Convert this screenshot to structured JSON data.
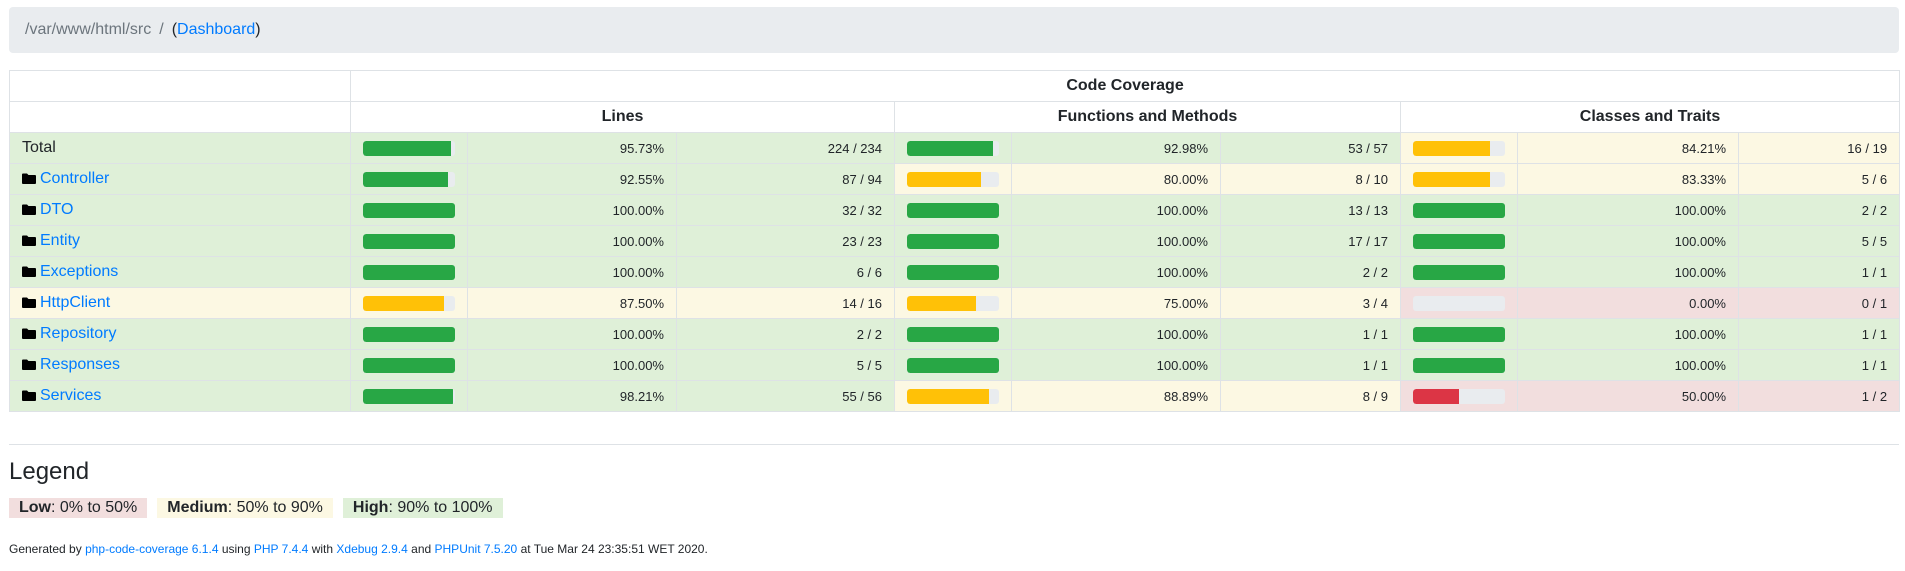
{
  "breadcrumb": {
    "path": "/var/www/html/src",
    "separator": "/",
    "open_paren": "(",
    "link": "Dashboard",
    "close_paren": ")"
  },
  "table": {
    "header_top": "Code Coverage",
    "group_headers": [
      "Lines",
      "Functions and Methods",
      "Classes and Traits"
    ],
    "rows": [
      {
        "name": "Total",
        "is_folder": false,
        "lines": {
          "pct": "95.73%",
          "ratio": "224 / 234",
          "fill": 95.73,
          "level": "high"
        },
        "funcs": {
          "pct": "92.98%",
          "ratio": "53 / 57",
          "fill": 92.98,
          "level": "high"
        },
        "classes": {
          "pct": "84.21%",
          "ratio": "16 / 19",
          "fill": 84.21,
          "level": "medium"
        }
      },
      {
        "name": "Controller",
        "is_folder": true,
        "lines": {
          "pct": "92.55%",
          "ratio": "87 / 94",
          "fill": 92.55,
          "level": "high"
        },
        "funcs": {
          "pct": "80.00%",
          "ratio": "8 / 10",
          "fill": 80.0,
          "level": "medium"
        },
        "classes": {
          "pct": "83.33%",
          "ratio": "5 / 6",
          "fill": 83.33,
          "level": "medium"
        }
      },
      {
        "name": "DTO",
        "is_folder": true,
        "lines": {
          "pct": "100.00%",
          "ratio": "32 / 32",
          "fill": 100,
          "level": "high"
        },
        "funcs": {
          "pct": "100.00%",
          "ratio": "13 / 13",
          "fill": 100,
          "level": "high"
        },
        "classes": {
          "pct": "100.00%",
          "ratio": "2 / 2",
          "fill": 100,
          "level": "high"
        }
      },
      {
        "name": "Entity",
        "is_folder": true,
        "lines": {
          "pct": "100.00%",
          "ratio": "23 / 23",
          "fill": 100,
          "level": "high"
        },
        "funcs": {
          "pct": "100.00%",
          "ratio": "17 / 17",
          "fill": 100,
          "level": "high"
        },
        "classes": {
          "pct": "100.00%",
          "ratio": "5 / 5",
          "fill": 100,
          "level": "high"
        }
      },
      {
        "name": "Exceptions",
        "is_folder": true,
        "lines": {
          "pct": "100.00%",
          "ratio": "6 / 6",
          "fill": 100,
          "level": "high"
        },
        "funcs": {
          "pct": "100.00%",
          "ratio": "2 / 2",
          "fill": 100,
          "level": "high"
        },
        "classes": {
          "pct": "100.00%",
          "ratio": "1 / 1",
          "fill": 100,
          "level": "high"
        }
      },
      {
        "name": "HttpClient",
        "is_folder": true,
        "lines": {
          "pct": "87.50%",
          "ratio": "14 / 16",
          "fill": 87.5,
          "level": "medium"
        },
        "funcs": {
          "pct": "75.00%",
          "ratio": "3 / 4",
          "fill": 75.0,
          "level": "medium"
        },
        "classes": {
          "pct": "0.00%",
          "ratio": "0 / 1",
          "fill": 0,
          "level": "low"
        }
      },
      {
        "name": "Repository",
        "is_folder": true,
        "lines": {
          "pct": "100.00%",
          "ratio": "2 / 2",
          "fill": 100,
          "level": "high"
        },
        "funcs": {
          "pct": "100.00%",
          "ratio": "1 / 1",
          "fill": 100,
          "level": "high"
        },
        "classes": {
          "pct": "100.00%",
          "ratio": "1 / 1",
          "fill": 100,
          "level": "high"
        }
      },
      {
        "name": "Responses",
        "is_folder": true,
        "lines": {
          "pct": "100.00%",
          "ratio": "5 / 5",
          "fill": 100,
          "level": "high"
        },
        "funcs": {
          "pct": "100.00%",
          "ratio": "1 / 1",
          "fill": 100,
          "level": "high"
        },
        "classes": {
          "pct": "100.00%",
          "ratio": "1 / 1",
          "fill": 100,
          "level": "high"
        }
      },
      {
        "name": "Services",
        "is_folder": true,
        "lines": {
          "pct": "98.21%",
          "ratio": "55 / 56",
          "fill": 98.21,
          "level": "high"
        },
        "funcs": {
          "pct": "88.89%",
          "ratio": "8 / 9",
          "fill": 88.89,
          "level": "medium"
        },
        "classes": {
          "pct": "50.00%",
          "ratio": "1 / 2",
          "fill": 50.0,
          "level": "low"
        }
      }
    ]
  },
  "legend": {
    "title": "Legend",
    "items": [
      {
        "label": "Low",
        "range": ": 0% to 50%",
        "level": "low"
      },
      {
        "label": "Medium",
        "range": ": 50% to 90%",
        "level": "medium"
      },
      {
        "label": "High",
        "range": ": 90% to 100%",
        "level": "high"
      }
    ]
  },
  "footer": {
    "generated_by": "Generated by",
    "tool": "php-code-coverage 6.1.4",
    "using": "using",
    "php": "PHP 7.4.4",
    "with": "with",
    "xdebug": "Xdebug 2.9.4",
    "and": "and",
    "phpunit": "PHPUnit 7.5.20",
    "at": "at Tue Mar 24 23:35:51 WET 2020."
  },
  "colors": {
    "high_bg": "#dff0d8",
    "medium_bg": "#fcf8e3",
    "low_bg": "#f2dede",
    "bar_success": "#28a745",
    "bar_warning": "#ffc107",
    "bar_danger": "#dc3545",
    "link": "#007bff"
  }
}
